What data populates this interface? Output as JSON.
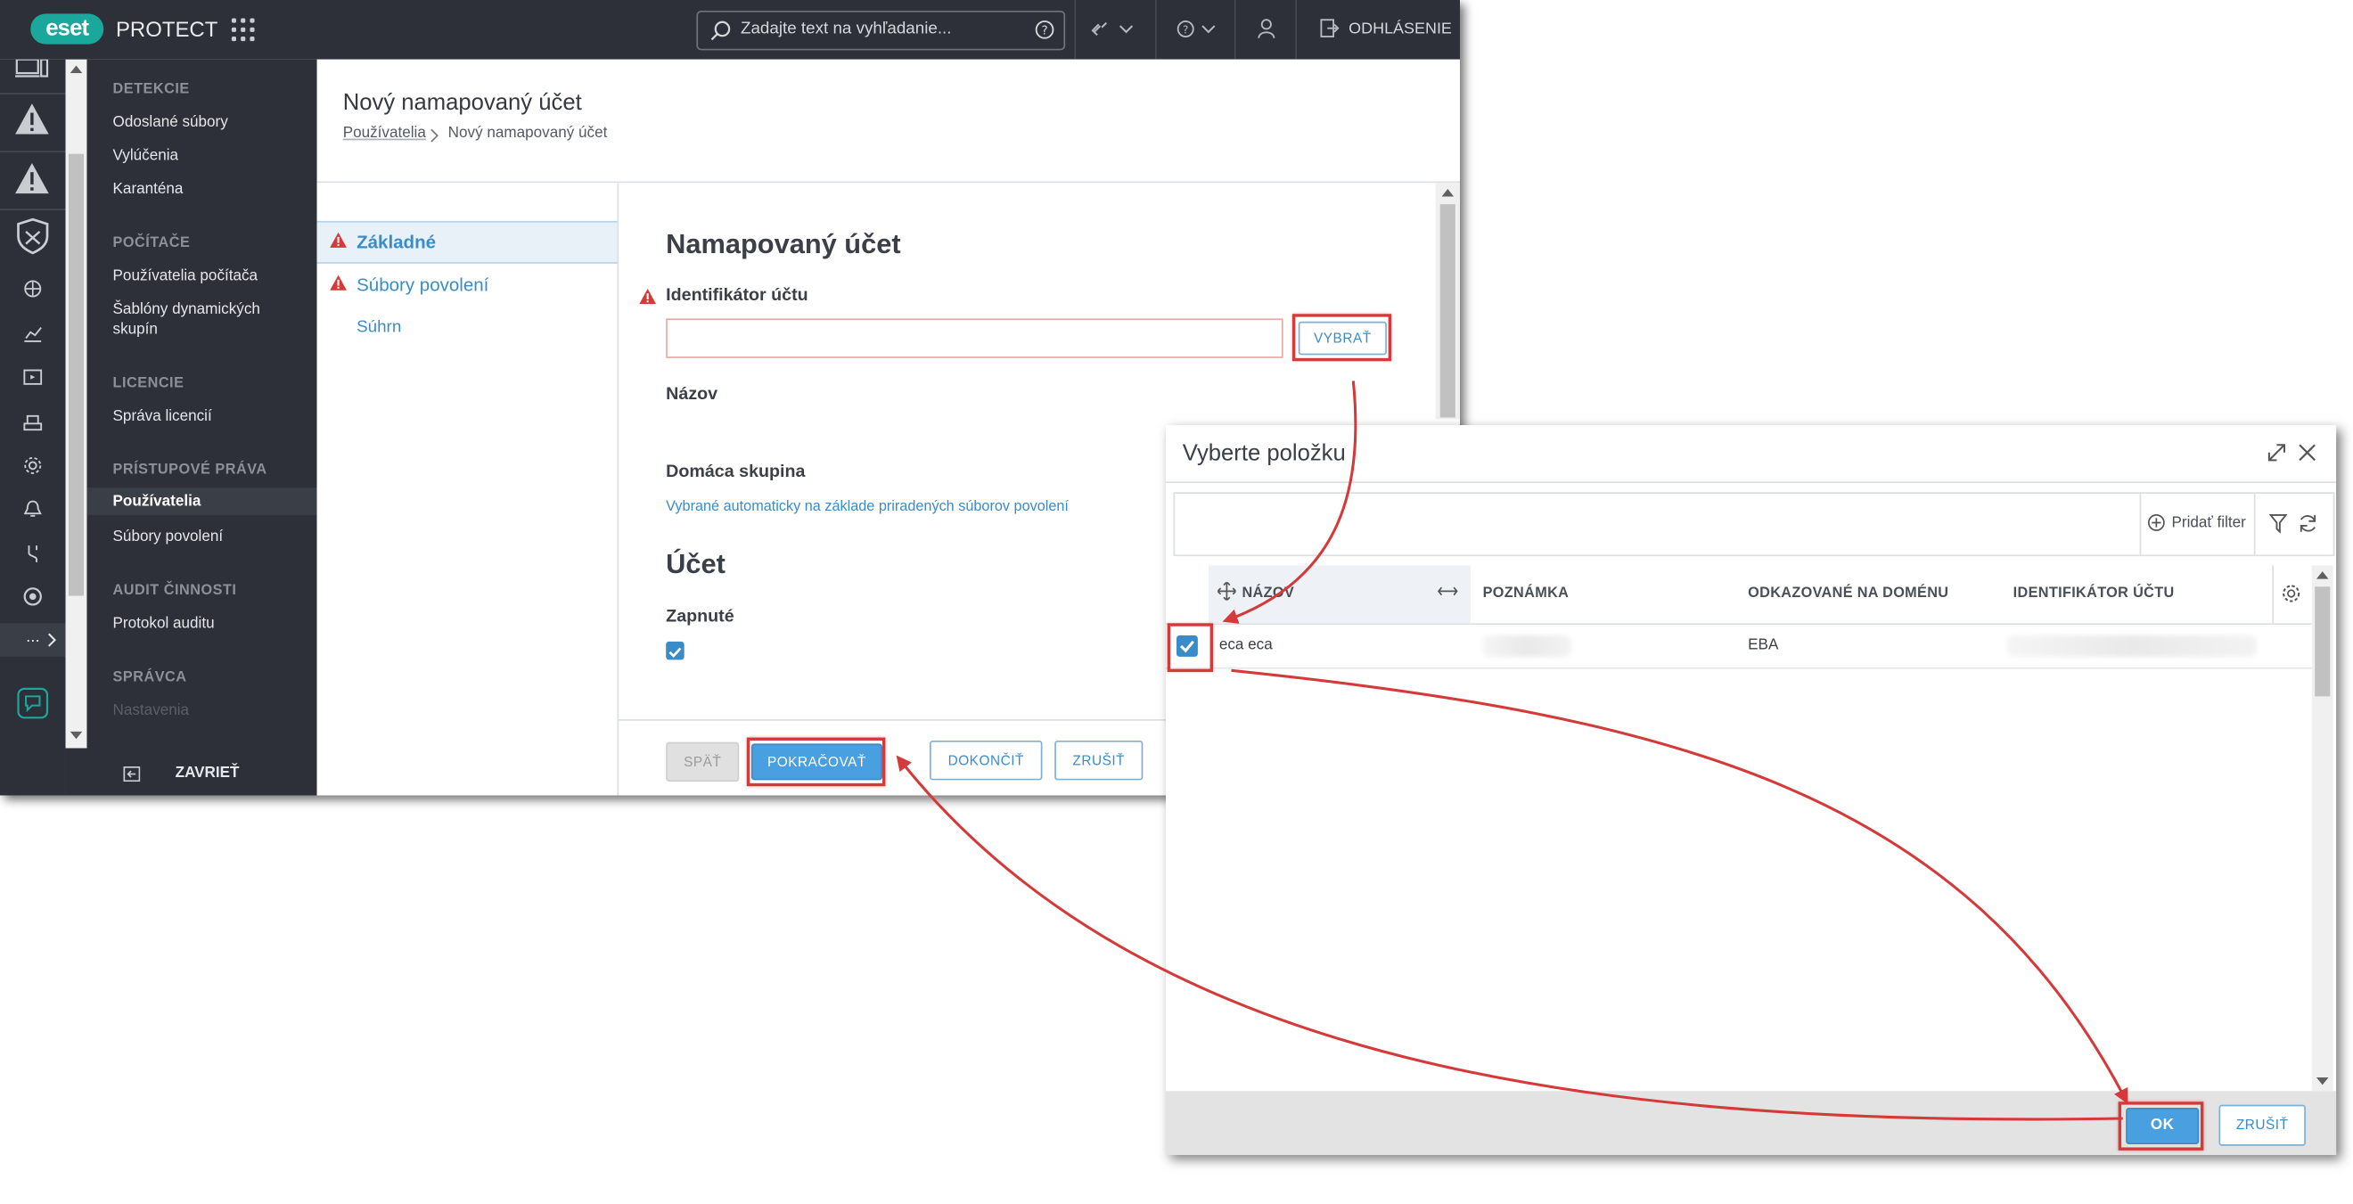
{
  "app": {
    "logo": "eset",
    "product": "PROTECT",
    "search_placeholder": "Zadajte text na vyhľadanie...",
    "logout": "ODHLÁSENIE"
  },
  "sidebar": {
    "sections": [
      {
        "title": "DETEKCIE",
        "items": [
          "Odoslané súbory",
          "Vylúčenia",
          "Karanténa"
        ]
      },
      {
        "title": "POČÍTAČE",
        "items": [
          "Používatelia počítača",
          "Šablóny dynamických skupín"
        ]
      },
      {
        "title": "LICENCIE",
        "items": [
          "Správa licencií"
        ]
      },
      {
        "title": "PRÍSTUPOVÉ PRÁVA",
        "items": [
          "Používatelia",
          "Súbory povolení"
        ]
      },
      {
        "title": "AUDIT ČINNOSTI",
        "items": [
          "Protokol auditu"
        ]
      },
      {
        "title": "SPRÁVCA",
        "items": [
          "Nastavenia"
        ]
      }
    ],
    "active_item": "Používatelia",
    "close_label": "ZAVRIEŤ",
    "rail_more": "..."
  },
  "page": {
    "title": "Nový namapovaný účet",
    "breadcrumb": [
      "Používatelia",
      "Nový namapovaný účet"
    ]
  },
  "wizard": {
    "steps": [
      "Základné",
      "Súbory povolení",
      "Súhrn"
    ],
    "section_title": "Namapovaný účet",
    "identifier_label": "Identifikátor účtu",
    "identifier_value": "",
    "select_button": "VYBRAŤ",
    "name_label": "Názov",
    "home_group_label": "Domáca skupina",
    "home_group_hint": "Vybrané automaticky na základe priradených súborov povolení",
    "account_title": "Účet",
    "enabled_label": "Zapnuté",
    "enabled": true,
    "buttons": {
      "back": "SPÄŤ",
      "continue": "POKRAČOVAŤ",
      "finish": "DOKONČIŤ",
      "cancel": "ZRUŠIŤ"
    }
  },
  "dialog": {
    "title": "Vyberte položku",
    "add_filter": "Pridať filter",
    "columns": [
      "NÁZOV",
      "POZNÁMKA",
      "ODKAZOVANÉ NA DOMÉNU",
      "IDENTIFIKÁTOR ÚČTU"
    ],
    "rows": [
      {
        "name": "eca eca",
        "note": "",
        "domain": "EBA",
        "identifier": "",
        "selected": true
      }
    ],
    "ok": "OK",
    "cancel": "ZRUŠIŤ"
  },
  "colors": {
    "topbar": "#2d3038",
    "accent": "#3a8cc8",
    "highlight": "#d43a3a",
    "brand": "#19a89b",
    "warning": "#d43a3a"
  }
}
